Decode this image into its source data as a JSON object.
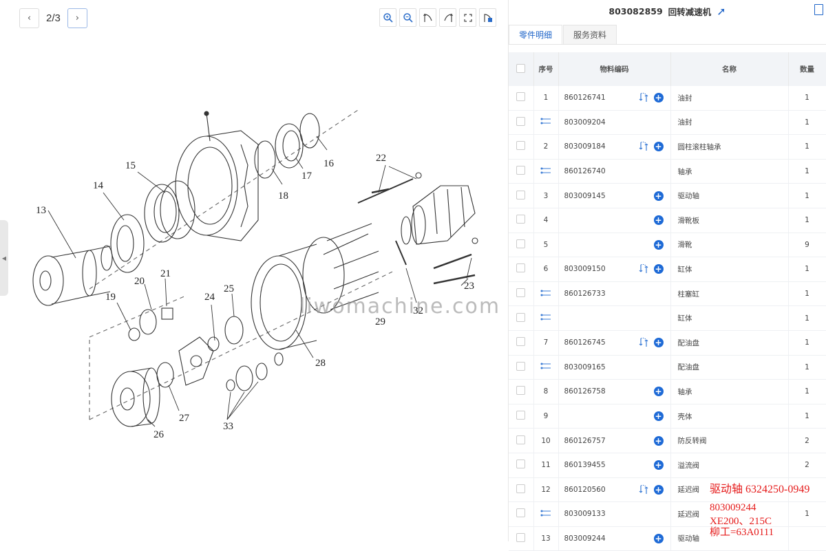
{
  "viewer": {
    "page_indicator": "2/3",
    "tools": [
      "zoom-in-icon",
      "zoom-out-icon",
      "rotate-left-icon",
      "rotate-right-icon",
      "fullscreen-icon",
      "reset-icon"
    ]
  },
  "diagram": {
    "callouts": [
      "13",
      "14",
      "15",
      "16",
      "17",
      "18",
      "19",
      "20",
      "21",
      "22",
      "23",
      "24",
      "25",
      "26",
      "27",
      "28",
      "29",
      "32",
      "33"
    ],
    "watermark": "liwomachine.com"
  },
  "header": {
    "code": "803082859",
    "title": "回转减速机"
  },
  "tabs": [
    {
      "label": "零件明细"
    },
    {
      "label": "服务资料"
    }
  ],
  "table": {
    "columns": {
      "seq": "序号",
      "code": "物料编码",
      "name": "名称",
      "qty": "数量"
    },
    "rows": [
      {
        "seq": "1",
        "code": "860126741",
        "name": "油封",
        "qty": "1",
        "swap": true,
        "plus": true,
        "sub": false
      },
      {
        "seq": "",
        "code": "803009204",
        "name": "油封",
        "qty": "1",
        "swap": false,
        "plus": false,
        "sub": true
      },
      {
        "seq": "2",
        "code": "803009184",
        "name": "圆柱滚柱轴承",
        "qty": "1",
        "swap": true,
        "plus": true,
        "sub": false
      },
      {
        "seq": "",
        "code": "860126740",
        "name": "轴承",
        "qty": "1",
        "swap": false,
        "plus": false,
        "sub": true
      },
      {
        "seq": "3",
        "code": "803009145",
        "name": "驱动轴",
        "qty": "1",
        "swap": false,
        "plus": true,
        "sub": false
      },
      {
        "seq": "4",
        "code": "",
        "name": "滑靴板",
        "qty": "1",
        "swap": false,
        "plus": true,
        "sub": false
      },
      {
        "seq": "5",
        "code": "",
        "name": "滑靴",
        "qty": "9",
        "swap": false,
        "plus": true,
        "sub": false
      },
      {
        "seq": "6",
        "code": "803009150",
        "name": "缸体",
        "qty": "1",
        "swap": true,
        "plus": true,
        "sub": false
      },
      {
        "seq": "",
        "code": "860126733",
        "name": "柱塞缸",
        "qty": "1",
        "swap": false,
        "plus": false,
        "sub": true
      },
      {
        "seq": "",
        "code": "",
        "name": "缸体",
        "qty": "1",
        "swap": false,
        "plus": false,
        "sub": true
      },
      {
        "seq": "7",
        "code": "860126745",
        "name": "配油盘",
        "qty": "1",
        "swap": true,
        "plus": true,
        "sub": false
      },
      {
        "seq": "",
        "code": "803009165",
        "name": "配油盘",
        "qty": "1",
        "swap": false,
        "plus": false,
        "sub": true
      },
      {
        "seq": "8",
        "code": "860126758",
        "name": "轴承",
        "qty": "1",
        "swap": false,
        "plus": true,
        "sub": false
      },
      {
        "seq": "9",
        "code": "",
        "name": "壳体",
        "qty": "1",
        "swap": false,
        "plus": true,
        "sub": false
      },
      {
        "seq": "10",
        "code": "860126757",
        "name": "防反转阀",
        "qty": "2",
        "swap": false,
        "plus": true,
        "sub": false
      },
      {
        "seq": "11",
        "code": "860139455",
        "name": "溢流阀",
        "qty": "2",
        "swap": false,
        "plus": true,
        "sub": false
      },
      {
        "seq": "12",
        "code": "860120560",
        "name": "延迟阀",
        "qty": "",
        "swap": true,
        "plus": true,
        "sub": false
      },
      {
        "seq": "",
        "code": "803009133",
        "name": "延迟阀",
        "qty": "1",
        "swap": false,
        "plus": false,
        "sub": true
      },
      {
        "seq": "13",
        "code": "803009244",
        "name": "驱动轴",
        "qty": "",
        "swap": false,
        "plus": true,
        "sub": false
      }
    ]
  },
  "overlay_note": {
    "line1": "驱动轴 6324250-0949",
    "line2": "803009244",
    "line3": "XE200、215C",
    "line4": "柳工=63A0111"
  },
  "colors": {
    "accent": "#1e64c8",
    "note": "#e51a1a",
    "header_bg": "#f2f4f7"
  }
}
